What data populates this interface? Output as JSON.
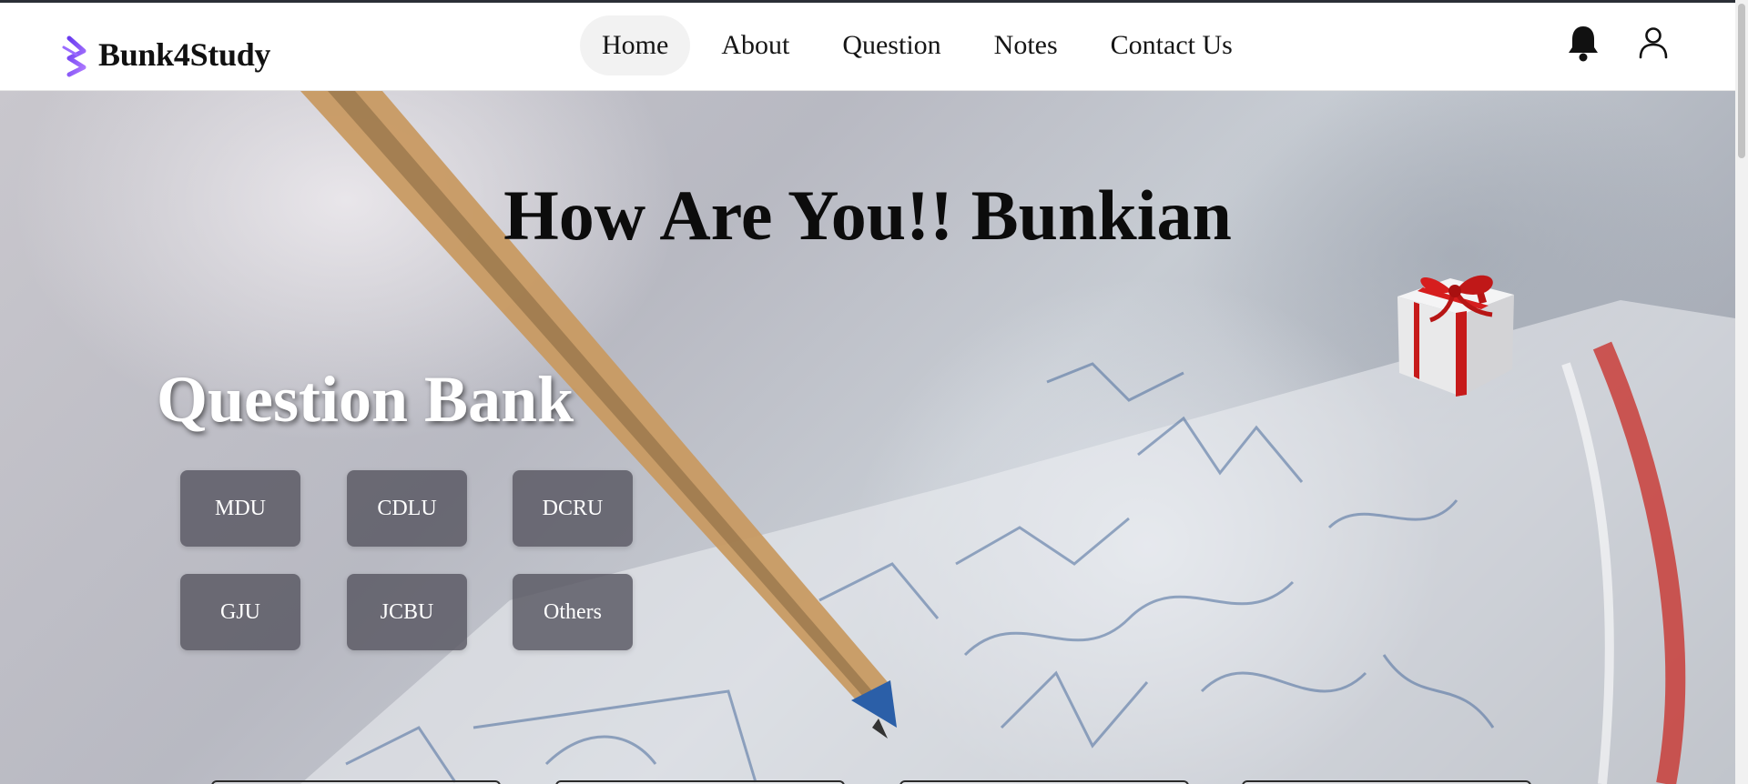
{
  "brand": {
    "name": "Bunk4Study",
    "logo_icon": "bunk4study-logo-icon",
    "accent": "#7b5cff"
  },
  "nav": {
    "items": [
      {
        "label": "Home",
        "active": true
      },
      {
        "label": "About",
        "active": false
      },
      {
        "label": "Question",
        "active": false
      },
      {
        "label": "Notes",
        "active": false
      },
      {
        "label": "Contact Us",
        "active": false
      }
    ],
    "bell_icon": "bell-icon",
    "user_icon": "user-icon"
  },
  "hero": {
    "title": "How Are You!! Bunkian",
    "gift_icon": "gift-box-icon"
  },
  "question_bank": {
    "title": "Question Bank",
    "universities": [
      "MDU",
      "CDLU",
      "DCRU",
      "GJU",
      "JCBU",
      "Others"
    ],
    "button_color": "#585762"
  }
}
